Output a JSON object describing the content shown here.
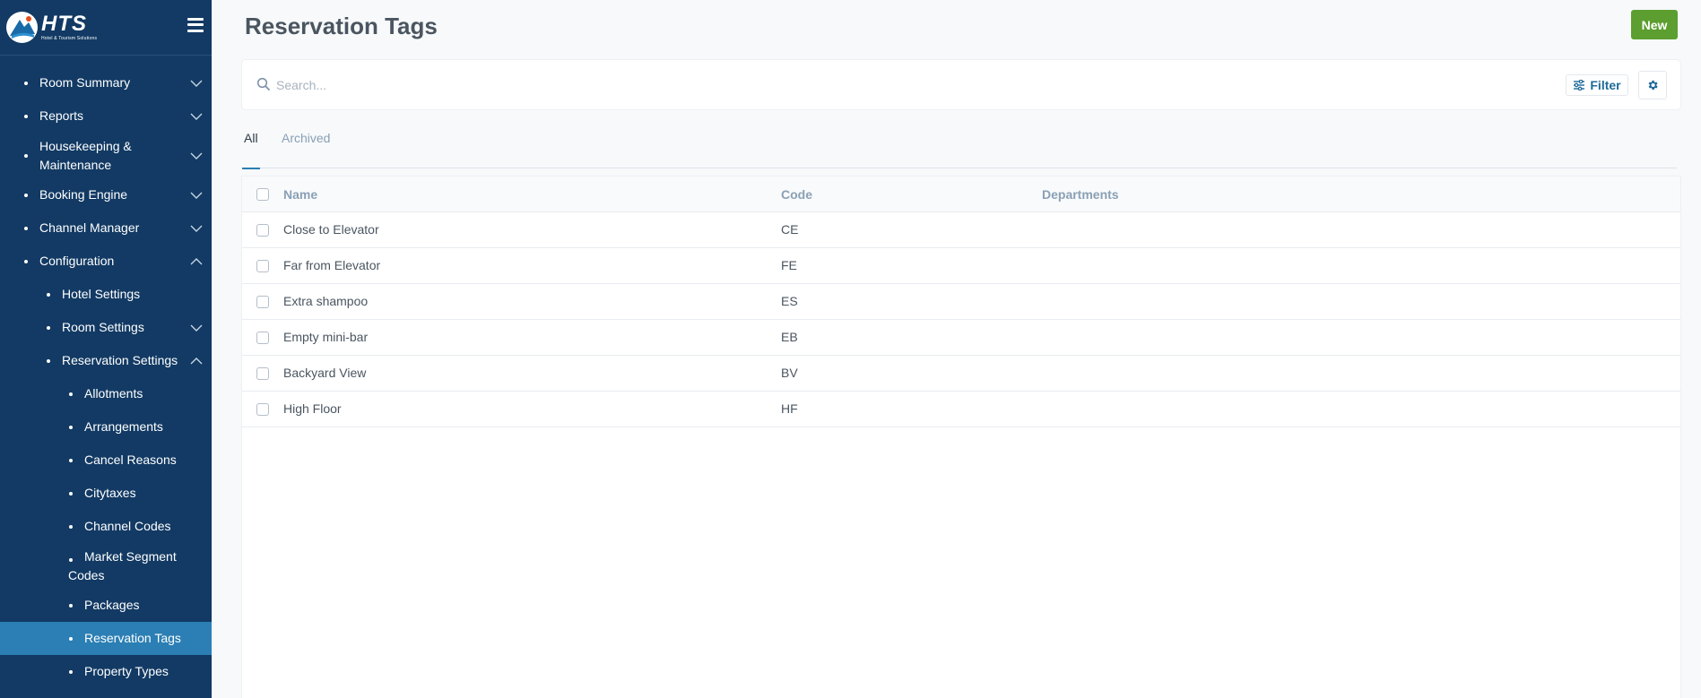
{
  "logo": {
    "main": "HTS",
    "sub": "Hotel & Tourism Solutions"
  },
  "sidebar": {
    "items": [
      {
        "label": "Room Summary",
        "level": 0,
        "chevron": "down"
      },
      {
        "label": "Reports",
        "level": 0,
        "chevron": "down"
      },
      {
        "label": "Housekeeping & Maintenance",
        "level": 0,
        "chevron": "down"
      },
      {
        "label": "Booking Engine",
        "level": 0,
        "chevron": "down"
      },
      {
        "label": "Channel Manager",
        "level": 0,
        "chevron": "down"
      },
      {
        "label": "Configuration",
        "level": 0,
        "chevron": "up"
      },
      {
        "label": "Hotel Settings",
        "level": 1,
        "chevron": ""
      },
      {
        "label": "Room Settings",
        "level": 1,
        "chevron": "down"
      },
      {
        "label": "Reservation Settings",
        "level": 1,
        "chevron": "up"
      },
      {
        "label": "Allotments",
        "level": 2
      },
      {
        "label": "Arrangements",
        "level": 2
      },
      {
        "label": "Cancel Reasons",
        "level": 2
      },
      {
        "label": "Citytaxes",
        "level": 2
      },
      {
        "label": "Channel Codes",
        "level": 2
      },
      {
        "label": "Market Segment Codes",
        "level": 2
      },
      {
        "label": "Packages",
        "level": 2
      },
      {
        "label": "Reservation Tags",
        "level": 2,
        "active": true
      },
      {
        "label": "Property Types",
        "level": 2
      }
    ]
  },
  "header": {
    "title": "Reservation Tags",
    "new_label": "New"
  },
  "search": {
    "placeholder": "Search...",
    "filter_label": "Filter"
  },
  "tabs": [
    {
      "label": "All",
      "active": true
    },
    {
      "label": "Archived",
      "active": false
    }
  ],
  "table": {
    "columns": [
      "Name",
      "Code",
      "Departments"
    ],
    "rows": [
      {
        "name": "Close to Elevator",
        "code": "CE",
        "departments": ""
      },
      {
        "name": "Far from Elevator",
        "code": "FE",
        "departments": ""
      },
      {
        "name": "Extra shampoo",
        "code": "ES",
        "departments": ""
      },
      {
        "name": "Empty mini-bar",
        "code": "EB",
        "departments": ""
      },
      {
        "name": "Backyard View",
        "code": "BV",
        "departments": ""
      },
      {
        "name": "High Floor",
        "code": "HF",
        "departments": ""
      }
    ]
  },
  "colors": {
    "sidebar_bg": "#123a64",
    "active_item": "#2b7fb4",
    "new_button": "#5c9e2f",
    "accent": "#2b7fb4"
  },
  "icons": {
    "menu": "hamburger-icon",
    "search": "search-icon",
    "filter": "sliders-icon",
    "settings": "gear-icon",
    "expand": "chevron-down-icon",
    "collapse": "chevron-up-icon"
  }
}
